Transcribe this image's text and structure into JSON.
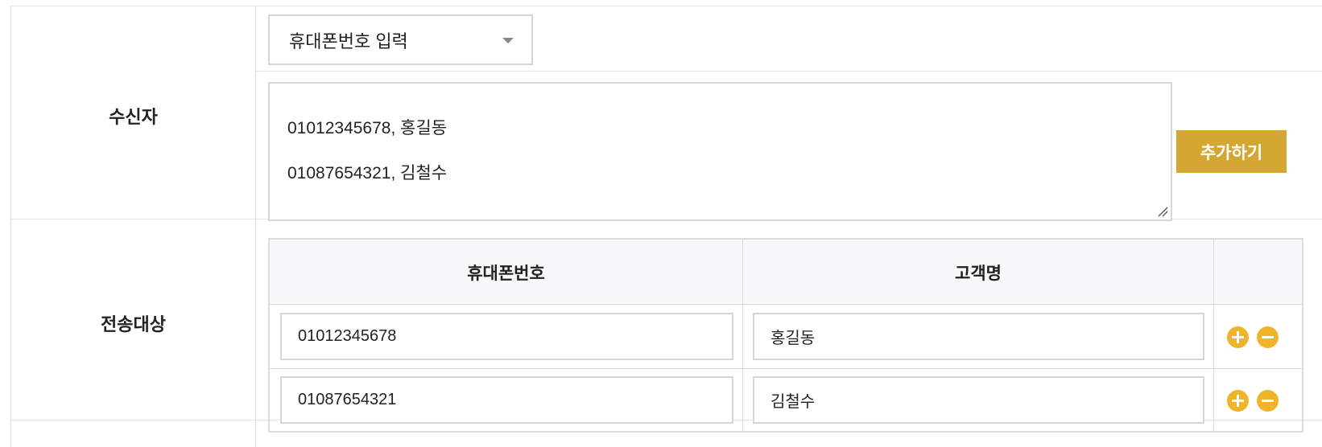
{
  "recipients": {
    "label": "수신자",
    "select_value": "휴대폰번호 입력",
    "textarea_lines": [
      "01012345678, 홍길동",
      "01087654321, 김철수"
    ],
    "textarea_value": "01012345678, 홍길동\n01087654321, 김철수",
    "add_button_label": "추가하기"
  },
  "targets": {
    "label": "전송대상",
    "columns": [
      "휴대폰번호",
      "고객명",
      ""
    ],
    "rows": [
      {
        "phone": "01012345678",
        "name": "홍길동"
      },
      {
        "phone": "01087654321",
        "name": "김철수"
      }
    ]
  },
  "colors": {
    "accent": "#d4a732",
    "icon_button": "#f0b429",
    "border": "#d6d6d6"
  },
  "icons": {
    "select_caret": "chevron-down-icon",
    "row_add": "plus-circle-icon",
    "row_remove": "minus-circle-icon",
    "textarea_resize": "resize-grip-icon"
  }
}
